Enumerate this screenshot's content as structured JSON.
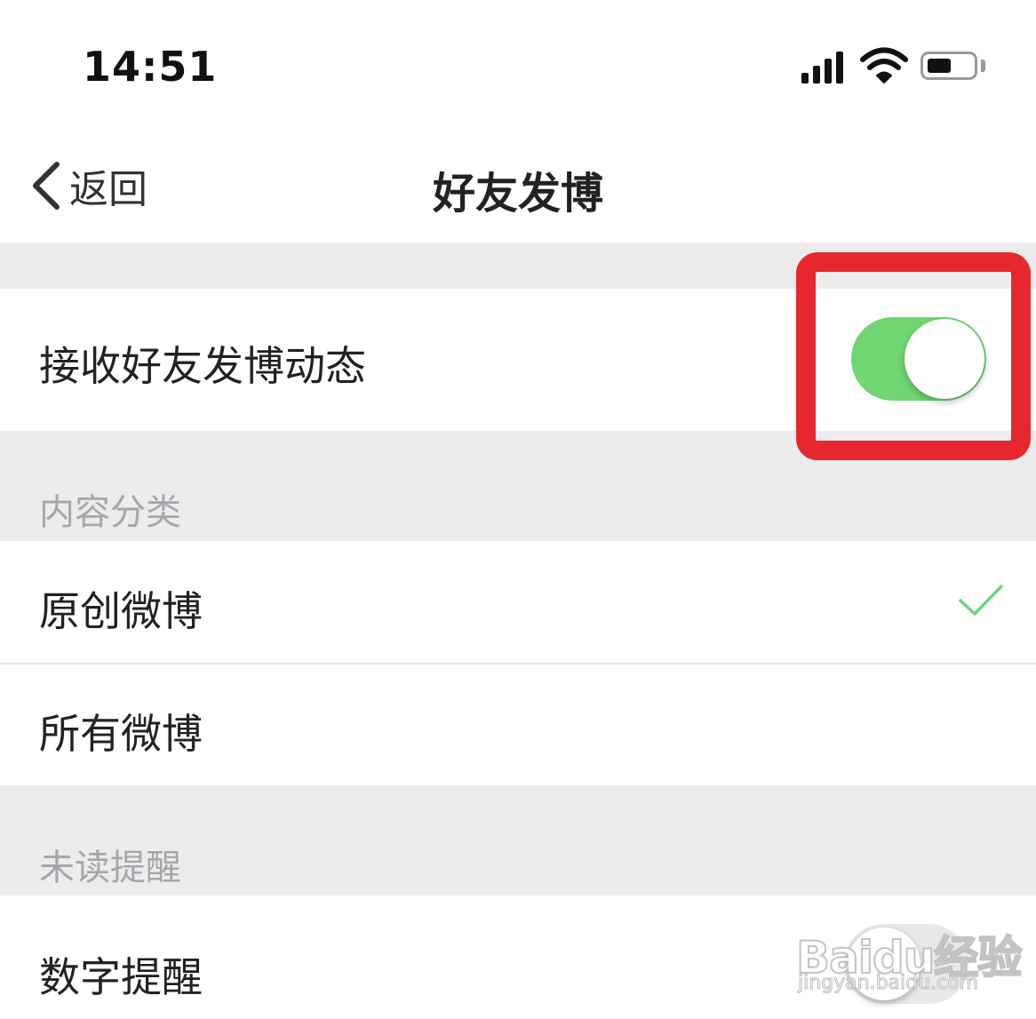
{
  "status_bar": {
    "time": "14:51",
    "icons": [
      "signal-icon",
      "wifi-icon",
      "battery-icon"
    ]
  },
  "nav": {
    "back_label": "返回",
    "title": "好友发博"
  },
  "settings": {
    "receive_row": {
      "label": "接收好友发博动态",
      "toggle_on": true
    },
    "content_section": {
      "header": "内容分类",
      "options": [
        {
          "label": "原创微博",
          "selected": true
        },
        {
          "label": "所有微博",
          "selected": false
        }
      ]
    },
    "unread_section": {
      "header": "未读提醒",
      "rows": [
        {
          "label": "数字提醒"
        }
      ]
    }
  },
  "watermark": {
    "logo": "Baidu经验",
    "url": "jingyan.baidu.com"
  },
  "colors": {
    "toggle_on": "#6fd672",
    "check": "#6fd672",
    "highlight": "#e6282e",
    "section_bg": "#ececee"
  }
}
